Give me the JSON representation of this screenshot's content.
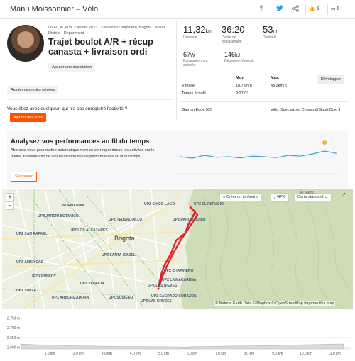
{
  "header": {
    "title": "Manu Moissonnier – Vélo",
    "kudos_count": "5",
    "comments_count": "0"
  },
  "activity": {
    "meta": "06:40, le jeudi 2 février 2023 · Localidad Chapinero, Bogota Capital District - Department",
    "title": "Trajet boulot A/R + récup canasta + livraison ordi",
    "add_description": "Ajouter une description"
  },
  "stats": {
    "distance": {
      "value": "11,32",
      "unit": "km",
      "label": "Distance"
    },
    "duration": {
      "value": "36:20",
      "label": "Durée de déplacement"
    },
    "elevation": {
      "value": "53",
      "unit": "m",
      "label": "Dénivelé"
    },
    "power": {
      "value": "67",
      "unit": "W",
      "label": "Puissance moy. estimée"
    },
    "energy": {
      "value": "146",
      "unit": "kJ",
      "label": "Dépense d'énergie"
    }
  },
  "details": {
    "develop_label": "Développer",
    "headers": {
      "avg": "Moy.",
      "max": "Max."
    },
    "rows": [
      {
        "label": "Vitesse",
        "avg": "18,7km/h",
        "max": "43,3km/h"
      },
      {
        "label": "Temps écoulé",
        "avg": "9:27:03",
        "max": ""
      }
    ],
    "device": "Garmin Edge 520",
    "bike": "Vélo: Specialized Crosstrail Sport Disc II"
  },
  "private_notes": "Ajouter des notes privées",
  "friend": {
    "question": "Vous étiez avec quelqu'un qui n'a pas enregistré l'activité ?",
    "button": "Ajouter des amis"
  },
  "performance": {
    "title": "Analysez vos performances au fil du temps",
    "text": "Abonnez-vous pour mettre automatiquement en correspondance les activités sur le même itinéraire afin de voir l'évolution de vos performances au fil du temps.",
    "subscribe": "S'abonner",
    "trend_values": [
      0.5,
      0.45,
      0.55,
      0.48,
      0.5,
      0.46,
      0.52,
      0.5,
      0.47,
      0.55,
      0.52,
      0.6,
      0.7,
      0.62
    ]
  },
  "map": {
    "zoom_in": "+",
    "zoom_out": "−",
    "create_route": "Créer un itinéraire",
    "gpx": "GPX",
    "map_style": "Carte standard",
    "city": "Bogota",
    "el_salitre": "El Saltre",
    "attribution": "© Natural Earth Data © Mapbox © OpenStreetMap Improve this map",
    "district_labels": [
      "UPZ CHICO LAGO",
      "NORMANDIA",
      "UPZ JARDIN BOTANICO",
      "UPZ TEUSAQUILLO",
      "UPZ LOS ALCAZARES",
      "UPZ CHAPINERO",
      "UPZ LAS NIEVES",
      "UPZ SAGRADO CORAZON",
      "UPZ AMERICAS",
      "UPZ SAN RAFAEL",
      "UPZ SANTA ISABEL",
      "UPZ EL REFUGIO",
      "UPZ PARDO RUBIO",
      "UPZ LA MACARENA",
      "UPZ LAS CRUCES",
      "UPZ SOSIEGO",
      "UPZ VENECIA",
      "UPZ ARBORIZADORA",
      "UPZ TIMIZA",
      "UPZ KENNEDY"
    ]
  },
  "elevation_profile": {
    "y_ticks": [
      "2.750 m",
      "2.700 m",
      "2.650 m",
      "2.600 m"
    ],
    "x_ticks": [
      "1,0 km",
      "2,0 km",
      "3,0 km",
      "4,0 km",
      "5,0 km",
      "6,0 km",
      "7,0 km",
      "8,0 km",
      "9,0 km",
      "10,0 km",
      "11,0 km"
    ],
    "chart_data": {
      "type": "area",
      "x": [
        0,
        0.5,
        1,
        1.5,
        2,
        2.5,
        3,
        3.5,
        4,
        4.5,
        5,
        5.5,
        5.8,
        6,
        6.5,
        7,
        7.5,
        8,
        8.5,
        9,
        9.5,
        10,
        10.5,
        11,
        11.32
      ],
      "y": [
        2615,
        2612,
        2610,
        2608,
        2606,
        2605,
        2604,
        2603,
        2603,
        2602,
        2602,
        2601,
        2599,
        2602,
        2603,
        2604,
        2605,
        2606,
        2607,
        2608,
        2610,
        2612,
        2613,
        2615,
        2616
      ],
      "ylim": [
        2590,
        2760
      ],
      "xlim": [
        0,
        11.6
      ]
    }
  },
  "colors": {
    "accent": "#fc5200",
    "route": "#e0202a",
    "trend": "#3aa6c4"
  }
}
